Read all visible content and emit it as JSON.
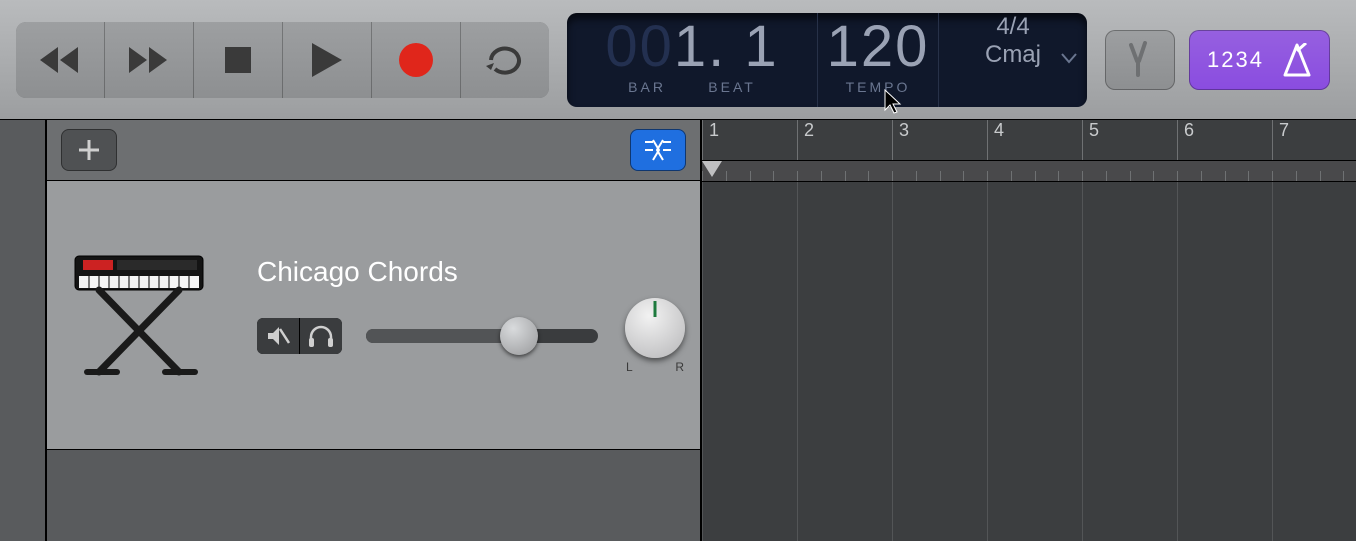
{
  "lcd": {
    "position_faded": "00",
    "position": "1. 1",
    "bar_label": "BAR",
    "beat_label": "BEAT",
    "tempo": "120",
    "tempo_label": "TEMPO",
    "time_sig": "4/4",
    "key": "Cmaj"
  },
  "count_in": {
    "label": "1234"
  },
  "track": {
    "name": "Chicago Chords",
    "pan_left": "L",
    "pan_right": "R",
    "volume_pct": 66
  },
  "ruler": {
    "numbers": [
      "1",
      "2",
      "3",
      "4",
      "5",
      "6",
      "7"
    ]
  }
}
